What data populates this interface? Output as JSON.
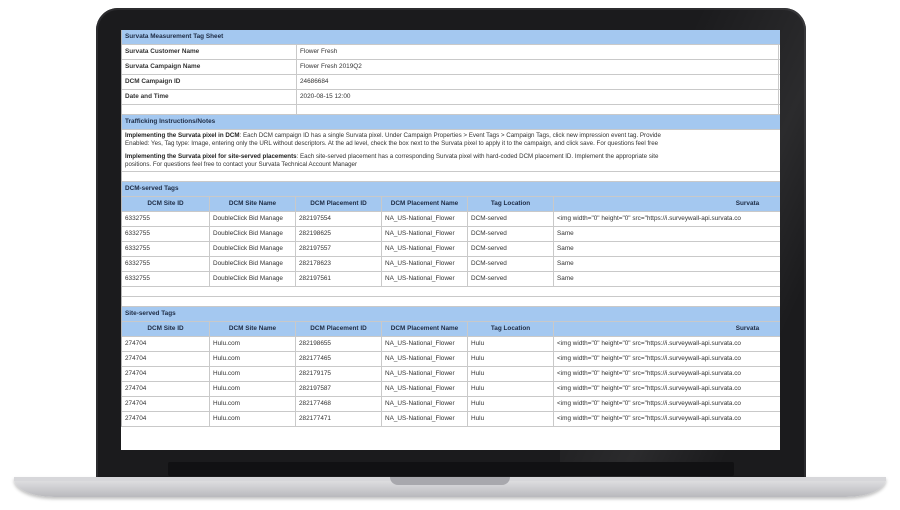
{
  "sheet": {
    "title": "Survata Measurement Tag Sheet",
    "info": [
      {
        "label": "Survata Customer Name",
        "value": "Flower Fresh"
      },
      {
        "label": "Survata Campaign Name",
        "value": "Flower Fresh 2019Q2"
      },
      {
        "label": "DCM Campaign ID",
        "value": "24686684"
      },
      {
        "label": "Date and Time",
        "value": "2020-08-15 12:00"
      }
    ],
    "trafficking": {
      "title": "Trafficking Instructions/Notes",
      "p1_bold": "Implementing the Survata pixel in DCM",
      "p1_line1": ": Each DCM campaign ID has a single Survata pixel. Under Campaign Properties > Event Tags > Campaign Tags, click new impression event tag. Provide",
      "p1_line2": "Enabled: Yes, Tag type: Image, entering only the URL without descriptors. At the ad level, check the box next to the Survata pixel to apply it to the campaign, and click save. For questions feel free",
      "p2_bold": "Implementing the Survata pixel for site-served placements",
      "p2_line1": ": Each site-served placement has a corresponding Survata pixel with hard-coded DCM placement ID. Implement the appropriate site",
      "p2_line2": "positions. For questions feel free to contact your Survata Technical Account Manager"
    },
    "dcm_section": {
      "title": "DCM-served Tags",
      "headers": [
        "DCM Site ID",
        "DCM Site Name",
        "DCM Placement ID",
        "DCM Placement Name",
        "Tag Location",
        "Survata"
      ],
      "rows": [
        [
          "6332755",
          "DoubleClick Bid Manage",
          "282197554",
          "NA_US-National_Flower",
          "DCM-served",
          "<img width=\"0\" height=\"0\" src=\"https://i.surveywall-api.survata.co"
        ],
        [
          "6332755",
          "DoubleClick Bid Manage",
          "282198625",
          "NA_US-National_Flower",
          "DCM-served",
          "Same"
        ],
        [
          "6332755",
          "DoubleClick Bid Manage",
          "282197557",
          "NA_US-National_Flower",
          "DCM-served",
          "Same"
        ],
        [
          "6332755",
          "DoubleClick Bid Manage",
          "282178623",
          "NA_US-National_Flower",
          "DCM-served",
          "Same"
        ],
        [
          "6332755",
          "DoubleClick Bid Manage",
          "282197561",
          "NA_US-National_Flower",
          "DCM-served",
          "Same"
        ]
      ]
    },
    "site_section": {
      "title": "Site-served Tags",
      "headers": [
        "DCM Site ID",
        "DCM Site Name",
        "DCM Placement ID",
        "DCM Placement Name",
        "Tag Location",
        "Survata"
      ],
      "rows": [
        [
          "274704",
          "Hulu.com",
          "282198655",
          "NA_US-National_Flower",
          "Hulu",
          "<img width=\"0\" height=\"0\" src=\"https://i.surveywall-api.survata.co"
        ],
        [
          "274704",
          "Hulu.com",
          "282177465",
          "NA_US-National_Flower",
          "Hulu",
          "<img width=\"0\" height=\"0\" src=\"https://i.surveywall-api.survata.co"
        ],
        [
          "274704",
          "Hulu.com",
          "282179175",
          "NA_US-National_Flower",
          "Hulu",
          "<img width=\"0\" height=\"0\" src=\"https://i.surveywall-api.survata.co"
        ],
        [
          "274704",
          "Hulu.com",
          "282197587",
          "NA_US-National_Flower",
          "Hulu",
          "<img width=\"0\" height=\"0\" src=\"https://i.surveywall-api.survata.co"
        ],
        [
          "274704",
          "Hulu.com",
          "282177468",
          "NA_US-National_Flower",
          "Hulu",
          "<img width=\"0\" height=\"0\" src=\"https://i.surveywall-api.survata.co"
        ],
        [
          "274704",
          "Hulu.com",
          "282177471",
          "NA_US-National_Flower",
          "Hulu",
          "<img width=\"0\" height=\"0\" src=\"https://i.surveywall-api.survata.co"
        ]
      ]
    }
  }
}
